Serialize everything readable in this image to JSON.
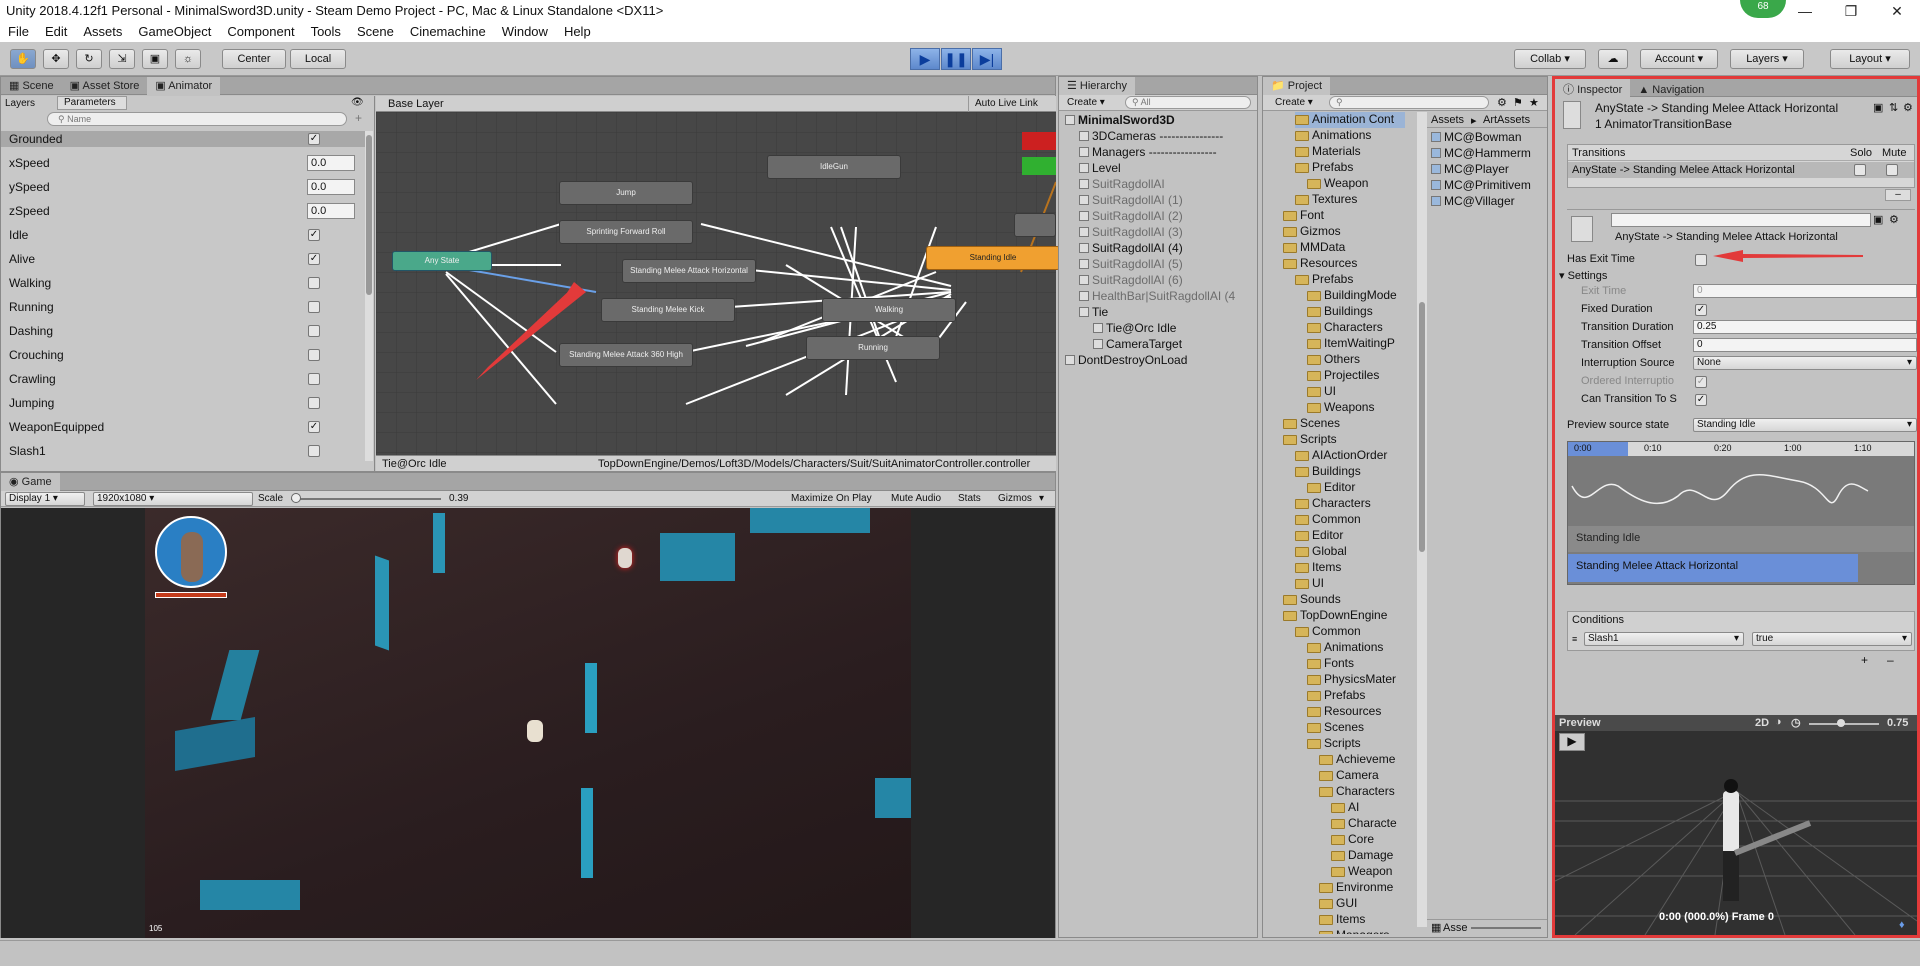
{
  "window": {
    "title": "Unity 2018.4.12f1 Personal - MinimalSword3D.unity - Steam Demo Project - PC, Mac & Linux Standalone <DX11>",
    "badge": "68"
  },
  "menu": [
    "File",
    "Edit",
    "Assets",
    "GameObject",
    "Component",
    "Tools",
    "Scene",
    "Cinemachine",
    "Window",
    "Help"
  ],
  "toolbar": {
    "center": "Center",
    "local": "Local",
    "collab": "Collab",
    "account": "Account",
    "layers": "Layers",
    "layout": "Layout"
  },
  "scene_tabs": [
    "Scene",
    "Asset Store",
    "Animator"
  ],
  "animator": {
    "layers_tab": "Layers",
    "params_tab": "Parameters",
    "search_placeholder": "Name",
    "base_layer": "Base Layer",
    "auto_live": "Auto Live Link",
    "params": [
      {
        "name": "Grounded",
        "type": "bool",
        "value": true
      },
      {
        "name": "xSpeed",
        "type": "float",
        "value": "0.0"
      },
      {
        "name": "ySpeed",
        "type": "float",
        "value": "0.0"
      },
      {
        "name": "zSpeed",
        "type": "float",
        "value": "0.0"
      },
      {
        "name": "Idle",
        "type": "bool",
        "value": true
      },
      {
        "name": "Alive",
        "type": "bool",
        "value": true
      },
      {
        "name": "Walking",
        "type": "bool",
        "value": false
      },
      {
        "name": "Running",
        "type": "bool",
        "value": false
      },
      {
        "name": "Dashing",
        "type": "bool",
        "value": false
      },
      {
        "name": "Crouching",
        "type": "bool",
        "value": false
      },
      {
        "name": "Crawling",
        "type": "bool",
        "value": false
      },
      {
        "name": "Jumping",
        "type": "bool",
        "value": false
      },
      {
        "name": "WeaponEquipped",
        "type": "bool",
        "value": true
      },
      {
        "name": "Slash1",
        "type": "bool",
        "value": false
      }
    ],
    "nodes": {
      "any": "Any State",
      "jump": "Jump",
      "sprint": "Sprinting Forward Roll",
      "melee_h": "Standing Melee Attack Horizontal",
      "kick": "Standing Melee Kick",
      "m360": "Standing Melee Attack 360 High",
      "idlegun": "IdleGun",
      "idle": "Standing Idle",
      "walking": "Walking",
      "running": "Running"
    },
    "status_left": "Tie@Orc Idle",
    "status_right": "TopDownEngine/Demos/Loft3D/Models/Characters/Suit/SuitAnimatorController.controller"
  },
  "game": {
    "tab": "Game",
    "display": "Display 1",
    "res": "1920x1080",
    "scale_label": "Scale",
    "scale": "0.39",
    "max": "Maximize On Play",
    "mute": "Mute Audio",
    "stats": "Stats",
    "gizmos": "Gizmos",
    "fps": "105"
  },
  "hierarchy": {
    "tab": "Hierarchy",
    "create": "Create",
    "search": "All",
    "rows": [
      {
        "t": "MinimalSword3D",
        "d": 0,
        "bold": true
      },
      {
        "t": "3DCameras ----------------",
        "d": 1
      },
      {
        "t": "Managers -----------------",
        "d": 1
      },
      {
        "t": "Level",
        "d": 1
      },
      {
        "t": "SuitRagdollAI",
        "d": 1,
        "dim": true
      },
      {
        "t": "SuitRagdollAI (1)",
        "d": 1,
        "dim": true
      },
      {
        "t": "SuitRagdollAI (2)",
        "d": 1,
        "dim": true
      },
      {
        "t": "SuitRagdollAI (3)",
        "d": 1,
        "dim": true
      },
      {
        "t": "SuitRagdollAI (4)",
        "d": 1
      },
      {
        "t": "SuitRagdollAI (5)",
        "d": 1,
        "dim": true
      },
      {
        "t": "SuitRagdollAI (6)",
        "d": 1,
        "dim": true
      },
      {
        "t": "HealthBar|SuitRagdollAI (4",
        "d": 1,
        "dim": true
      },
      {
        "t": "Tie",
        "d": 1
      },
      {
        "t": "Tie@Orc Idle",
        "d": 2
      },
      {
        "t": "CameraTarget",
        "d": 2
      },
      {
        "t": "DontDestroyOnLoad",
        "d": 0
      }
    ]
  },
  "project": {
    "tab": "Project",
    "create": "Create",
    "tree": [
      {
        "t": "Animation Cont",
        "d": 2
      },
      {
        "t": "Animations",
        "d": 2
      },
      {
        "t": "Materials",
        "d": 2
      },
      {
        "t": "Prefabs",
        "d": 2
      },
      {
        "t": "Weapon",
        "d": 3
      },
      {
        "t": "Textures",
        "d": 2
      },
      {
        "t": "Font",
        "d": 1
      },
      {
        "t": "Gizmos",
        "d": 1
      },
      {
        "t": "MMData",
        "d": 1
      },
      {
        "t": "Resources",
        "d": 1
      },
      {
        "t": "Prefabs",
        "d": 2
      },
      {
        "t": "BuildingMode",
        "d": 3
      },
      {
        "t": "Buildings",
        "d": 3
      },
      {
        "t": "Characters",
        "d": 3
      },
      {
        "t": "ItemWaitingP",
        "d": 3
      },
      {
        "t": "Others",
        "d": 3
      },
      {
        "t": "Projectiles",
        "d": 3
      },
      {
        "t": "UI",
        "d": 3
      },
      {
        "t": "Weapons",
        "d": 3
      },
      {
        "t": "Scenes",
        "d": 1
      },
      {
        "t": "Scripts",
        "d": 1
      },
      {
        "t": "AIActionOrder",
        "d": 2
      },
      {
        "t": "Buildings",
        "d": 2
      },
      {
        "t": "Editor",
        "d": 3
      },
      {
        "t": "Characters",
        "d": 2
      },
      {
        "t": "Common",
        "d": 2
      },
      {
        "t": "Editor",
        "d": 2
      },
      {
        "t": "Global",
        "d": 2
      },
      {
        "t": "Items",
        "d": 2
      },
      {
        "t": "UI",
        "d": 2
      },
      {
        "t": "Sounds",
        "d": 1
      },
      {
        "t": "TopDownEngine",
        "d": 1
      },
      {
        "t": "Common",
        "d": 2
      },
      {
        "t": "Animations",
        "d": 3
      },
      {
        "t": "Fonts",
        "d": 3
      },
      {
        "t": "PhysicsMater",
        "d": 3
      },
      {
        "t": "Prefabs",
        "d": 3
      },
      {
        "t": "Resources",
        "d": 3
      },
      {
        "t": "Scenes",
        "d": 3
      },
      {
        "t": "Scripts",
        "d": 3
      },
      {
        "t": "Achieveme",
        "d": 4
      },
      {
        "t": "Camera",
        "d": 4
      },
      {
        "t": "Characters",
        "d": 4
      },
      {
        "t": "AI",
        "d": 5
      },
      {
        "t": "Characte",
        "d": 5
      },
      {
        "t": "Core",
        "d": 5
      },
      {
        "t": "Damage",
        "d": 5
      },
      {
        "t": "Weapon",
        "d": 5
      },
      {
        "t": "Environme",
        "d": 4
      },
      {
        "t": "GUI",
        "d": 4
      },
      {
        "t": "Items",
        "d": 4
      },
      {
        "t": "Managers",
        "d": 4
      }
    ],
    "breadcrumb": [
      "Assets",
      "ArtAssets"
    ],
    "assets": [
      "MC@Bowman",
      "MC@Hammerm",
      "MC@Player",
      "MC@Primitivem",
      "MC@Villager"
    ],
    "footer": "Asse"
  },
  "inspector": {
    "tab": "Inspector",
    "nav_tab": "Navigation",
    "title": "AnyState -> Standing Melee Attack Horizontal",
    "subtitle": "1 AnimatorTransitionBase",
    "transitions_label": "Transitions",
    "solo": "Solo",
    "mute": "Mute",
    "transition_row": "AnyState -> Standing Melee Attack Horizontal",
    "trans_name": "AnyState -> Standing Melee Attack Horizontal",
    "has_exit": "Has Exit Time",
    "settings": "Settings",
    "exit_time_label": "Exit Time",
    "exit_time": "0",
    "fixed_duration": "Fixed Duration",
    "trans_duration_label": "Transition Duration",
    "trans_duration": "0.25",
    "trans_offset_label": "Transition Offset",
    "trans_offset": "0",
    "interruption_label": "Interruption Source",
    "interruption": "None",
    "ordered_label": "Ordered Interruptio",
    "can_trans_label": "Can Transition To S",
    "preview_source_label": "Preview source state",
    "preview_source": "Standing Idle",
    "timeline_ticks": [
      "0:00",
      "0:10",
      "0:20",
      "1:00",
      "1:10"
    ],
    "track_idle": "Standing Idle",
    "track_melee": "Standing Melee Attack Horizontal",
    "conditions": "Conditions",
    "cond_param": "Slash1",
    "cond_value": "true",
    "preview": "Preview",
    "mode_2d": "2D",
    "speed": "0.75",
    "preview_status": "0:00 (000.0%) Frame 0"
  },
  "colors": {
    "highlight": "#e23a3a",
    "accent_blue": "#5d88cc",
    "idle_orange": "#f0a030",
    "any_green": "#4aa88a"
  }
}
